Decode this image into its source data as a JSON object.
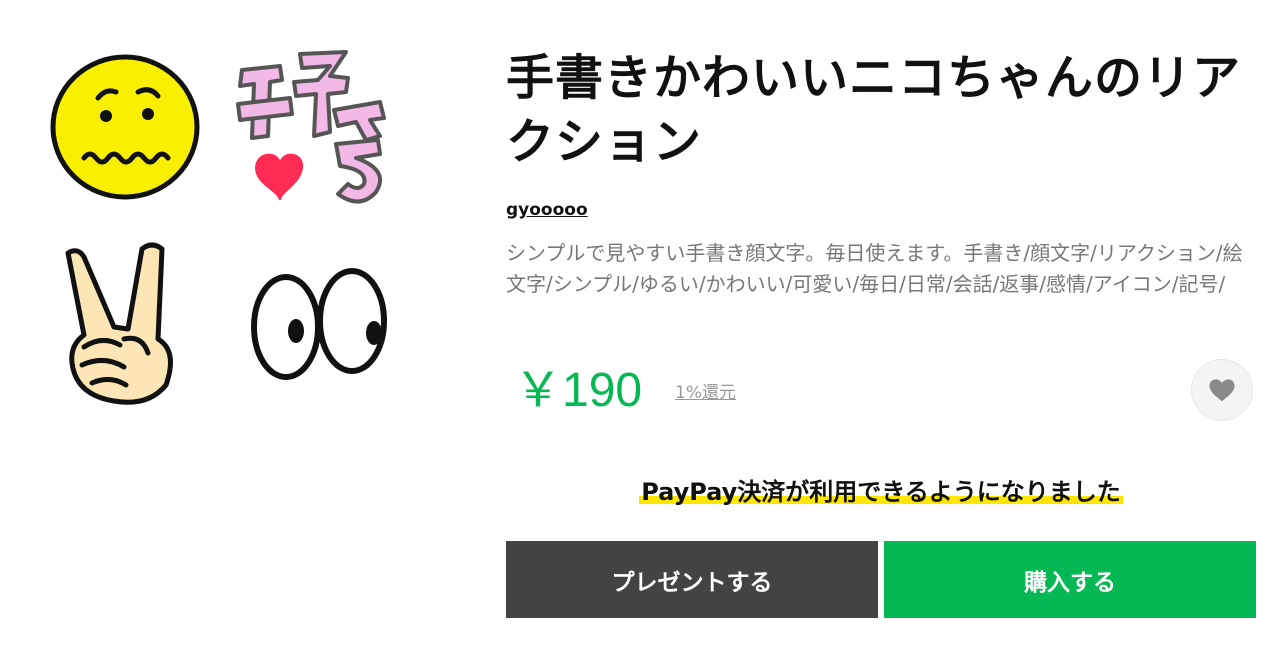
{
  "stickers": [
    {
      "name": "worried-face-sticker"
    },
    {
      "name": "suki-love-sticker"
    },
    {
      "name": "peace-sign-sticker"
    },
    {
      "name": "big-eyes-sticker"
    }
  ],
  "product": {
    "title": "手書きかわいいニコちゃんのリアクション",
    "author": "gyooooo",
    "description": "シンプルで見やすい手書き顔文字。毎日使えます。手書き/顔文字/リアクション/絵文字/シンプル/ゆるい/かわいい/可愛い/毎日/日常/会話/返事/感情/アイコン/記号/",
    "price": "￥190",
    "cashback": "1%還元"
  },
  "notice": {
    "text": "PayPay決済が利用できるようになりました",
    "highlight_color": "#ffe600"
  },
  "actions": {
    "gift_label": "プレゼントする",
    "buy_label": "購入する"
  },
  "colors": {
    "accent_green": "#06b853",
    "gift_button": "#434343",
    "favorite_icon": "#8a8a8a"
  }
}
